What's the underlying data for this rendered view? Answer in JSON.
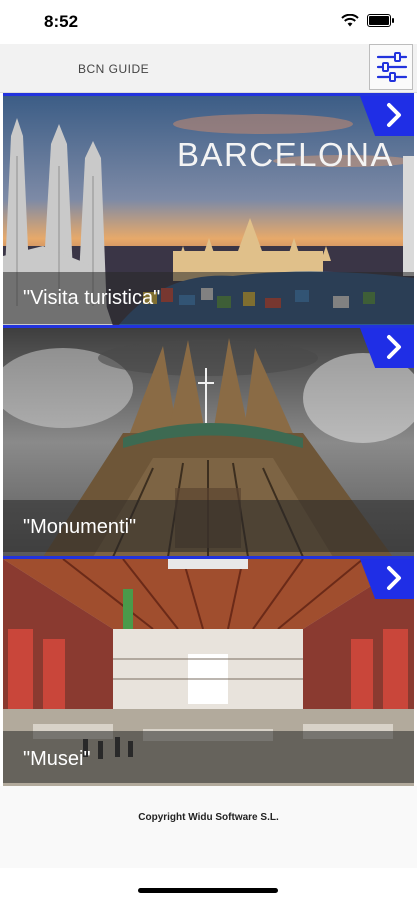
{
  "status_bar": {
    "time": "8:52"
  },
  "nav": {
    "title": "BCN GUIDE",
    "filter_icon": "sliders-icon"
  },
  "panels": [
    {
      "title": "BARCELONA",
      "caption": "\"Visita turistica\"",
      "icon": "chevron-right-icon"
    },
    {
      "caption": "\"Monumenti\"",
      "icon": "chevron-right-icon"
    },
    {
      "caption": "\"Musei\"",
      "icon": "chevron-right-icon"
    }
  ],
  "footer": {
    "copyright": "Copyright Widu Software S.L."
  },
  "colors": {
    "accent": "#1f2ee6"
  }
}
